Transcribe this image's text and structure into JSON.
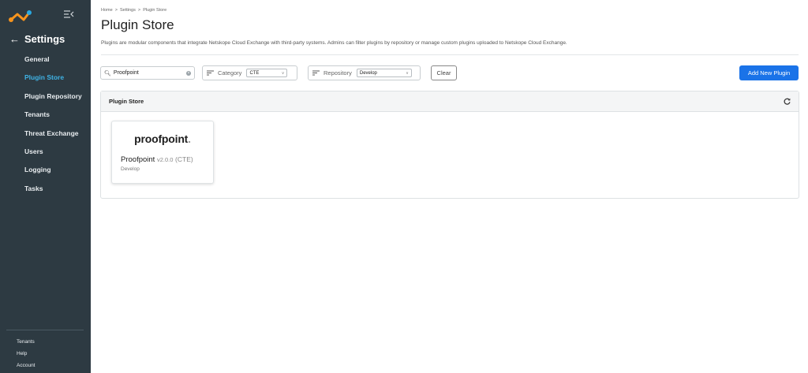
{
  "sidebar": {
    "title": "Settings",
    "items": [
      {
        "label": "General"
      },
      {
        "label": "Plugin Store"
      },
      {
        "label": "Plugin Repository"
      },
      {
        "label": "Tenants"
      },
      {
        "label": "Threat Exchange"
      },
      {
        "label": "Users"
      },
      {
        "label": "Logging"
      },
      {
        "label": "Tasks"
      }
    ],
    "active_item": "Plugin Store",
    "footer": [
      {
        "label": "Tenants"
      },
      {
        "label": "Help"
      },
      {
        "label": "Account"
      }
    ]
  },
  "breadcrumb": "Home  >  Settings  >  Plugin Store",
  "page": {
    "title": "Plugin Store",
    "description": "Plugins are modular components that integrate Netskope Cloud Exchange with third-party systems. Admins can filter plugins by repository or manage custom plugins uploaded to Netskope Cloud Exchange."
  },
  "toolbar": {
    "search_value": "Proofpoint",
    "category_label": "Category",
    "category_value": "CTE",
    "repository_label": "Repository",
    "repository_value": "Develop",
    "clear_label": "Clear",
    "add_label": "Add New Plugin"
  },
  "store": {
    "header": "Plugin Store",
    "plugins": [
      {
        "logo_text": "proofpoint",
        "logo_dot": ".",
        "name": "Proofpoint",
        "version": "v2.0.0",
        "category": "(CTE)",
        "repository": "Develop"
      }
    ]
  },
  "colors": {
    "sidebar_bg": "#2d3a42",
    "active_nav": "#3fb3e6",
    "primary_button": "#1a73e8",
    "logo_orange": "#f7941d",
    "logo_blue": "#29a9e1"
  }
}
